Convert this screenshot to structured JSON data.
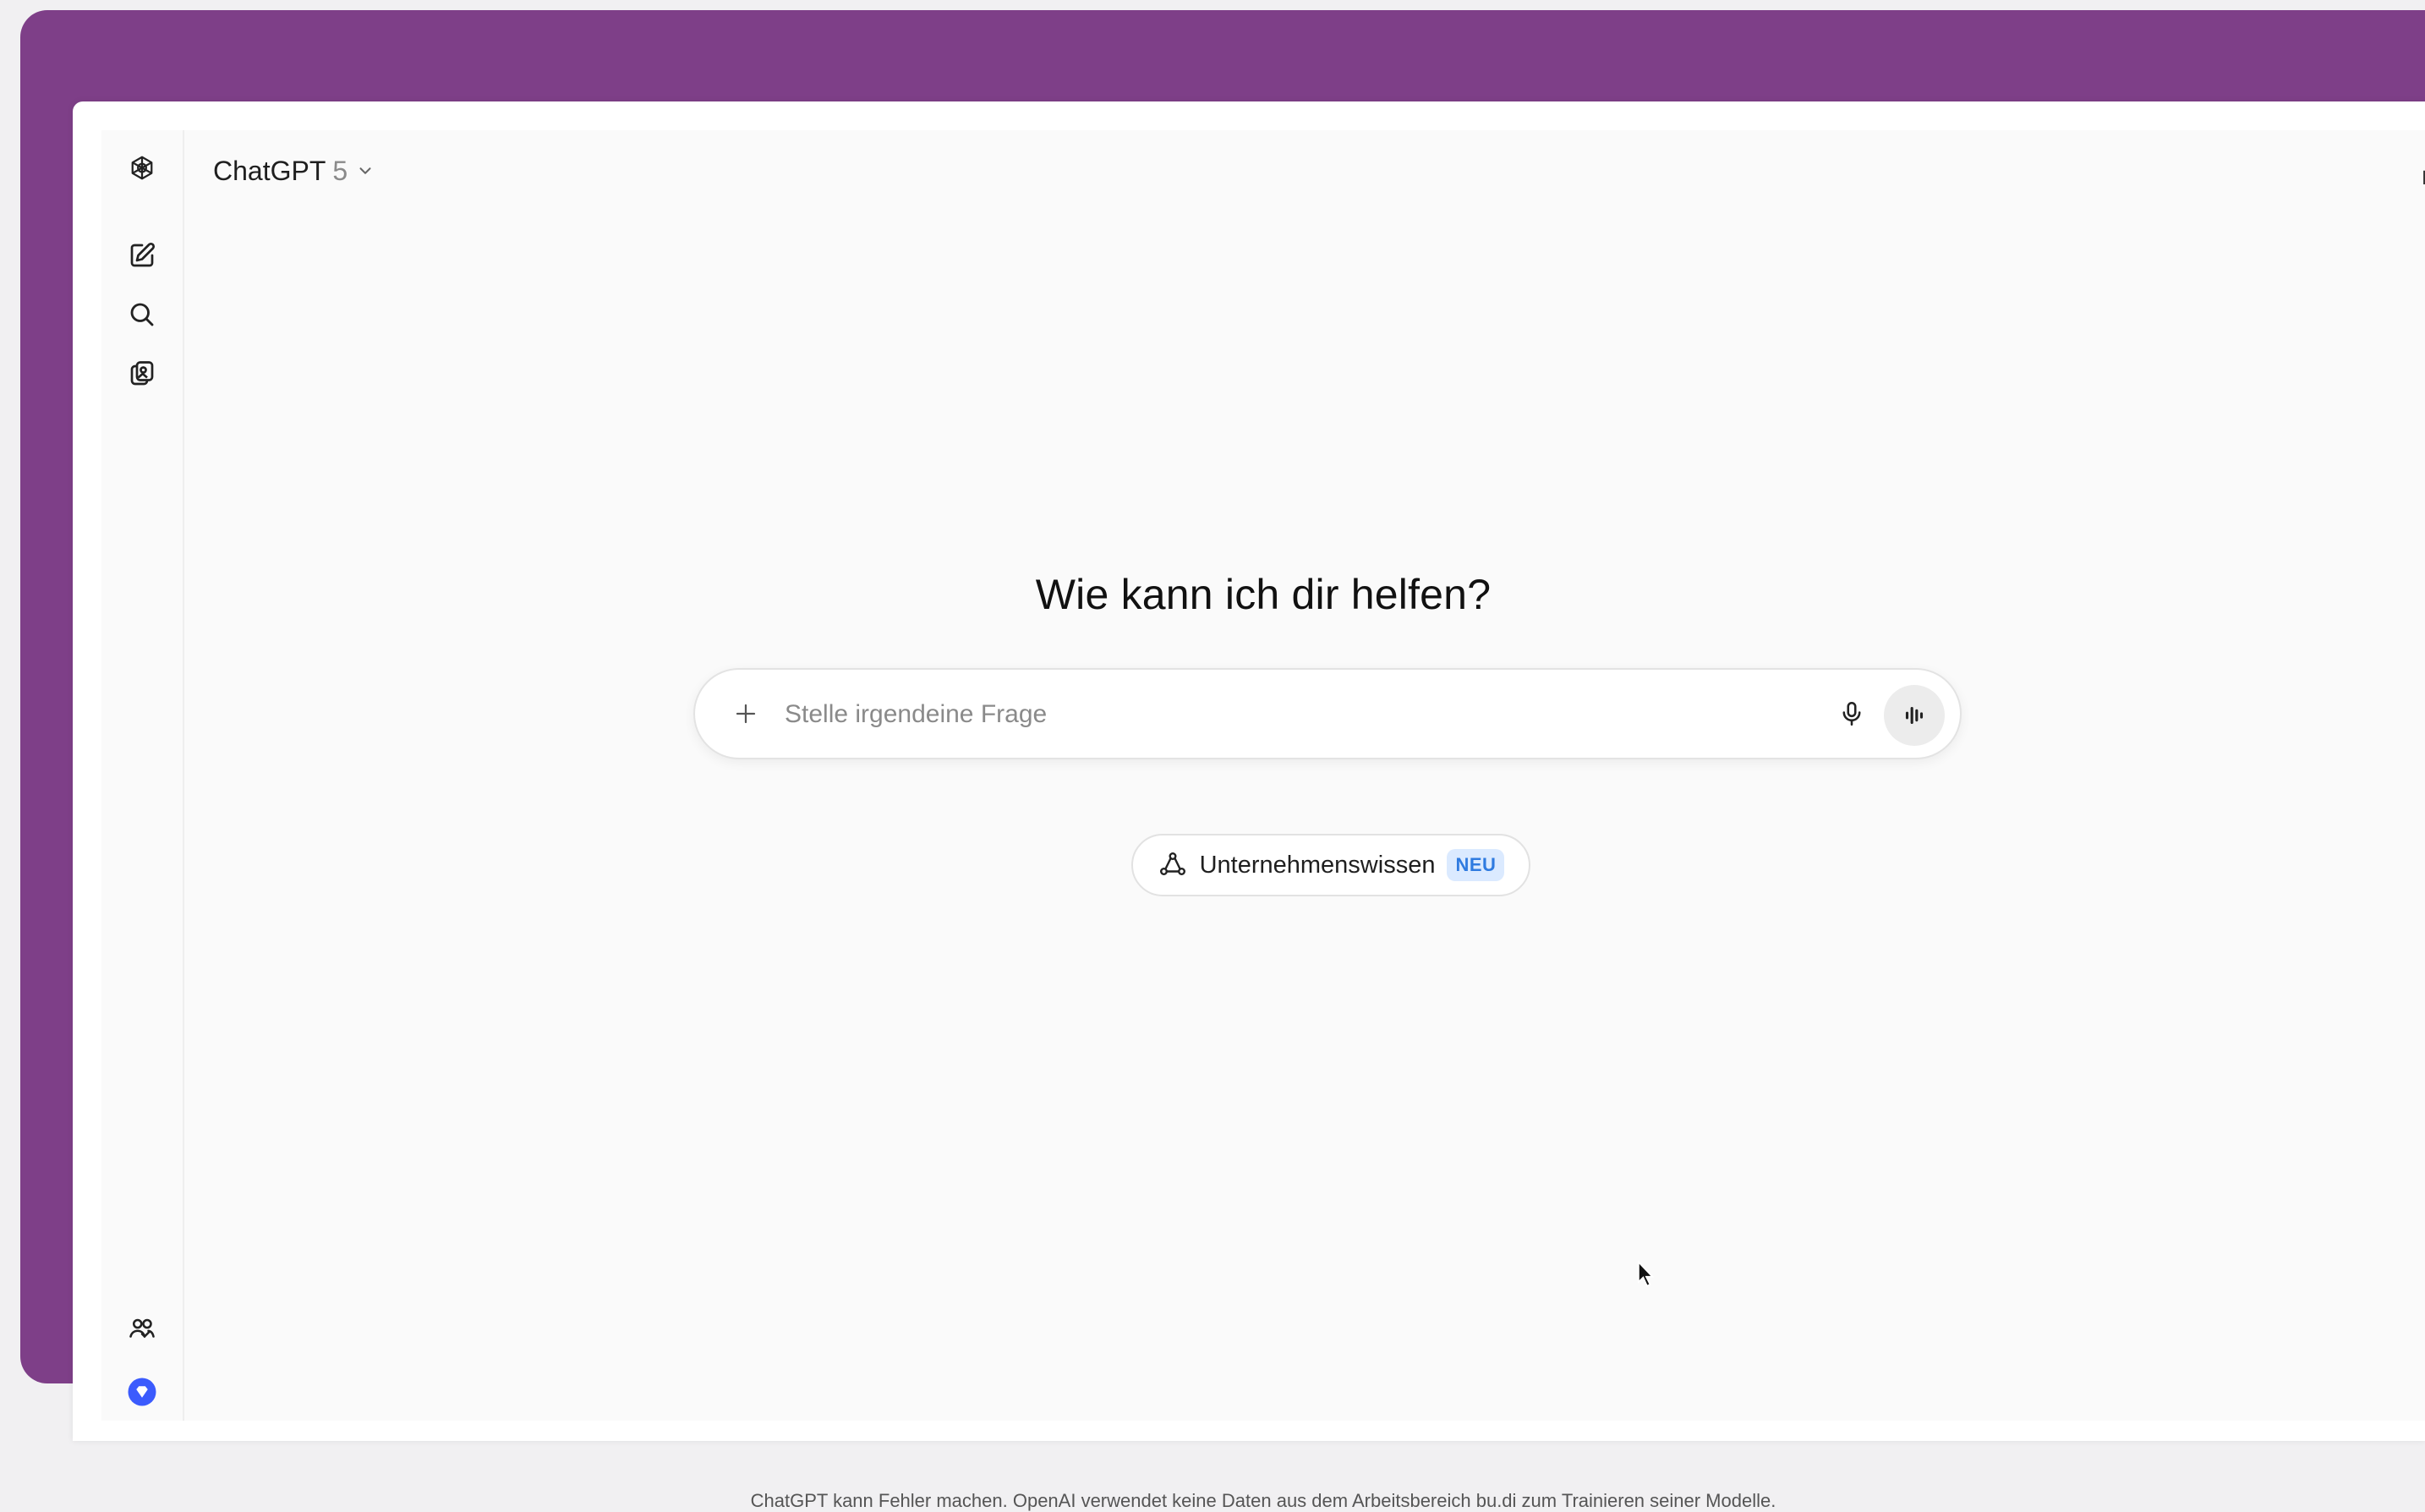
{
  "header": {
    "model_name": "ChatGPT",
    "model_version": "5"
  },
  "sidebar": {
    "items": [
      {
        "name": "logo",
        "icon": "openai-logo-icon"
      },
      {
        "name": "new-chat",
        "icon": "new-chat-icon"
      },
      {
        "name": "search",
        "icon": "search-icon"
      },
      {
        "name": "library",
        "icon": "library-icon"
      }
    ],
    "bottom": [
      {
        "name": "team",
        "icon": "team-icon"
      },
      {
        "name": "upgrade",
        "icon": "gem-icon"
      }
    ]
  },
  "main": {
    "greeting": "Wie kann ich dir helfen?",
    "composer": {
      "placeholder": "Stelle irgendeine Frage"
    },
    "chip": {
      "label": "Unternehmenswissen",
      "badge": "NEU"
    },
    "disclaimer": "ChatGPT kann Fehler machen. OpenAI verwendet keine Daten aus dem Arbeitsbereich bu.di zum Trainieren seiner Modelle."
  },
  "colors": {
    "backdrop": "#7e3f88",
    "accent": "#3b5bfd",
    "badge_bg": "#dbeaff",
    "badge_text": "#2f7be0"
  }
}
